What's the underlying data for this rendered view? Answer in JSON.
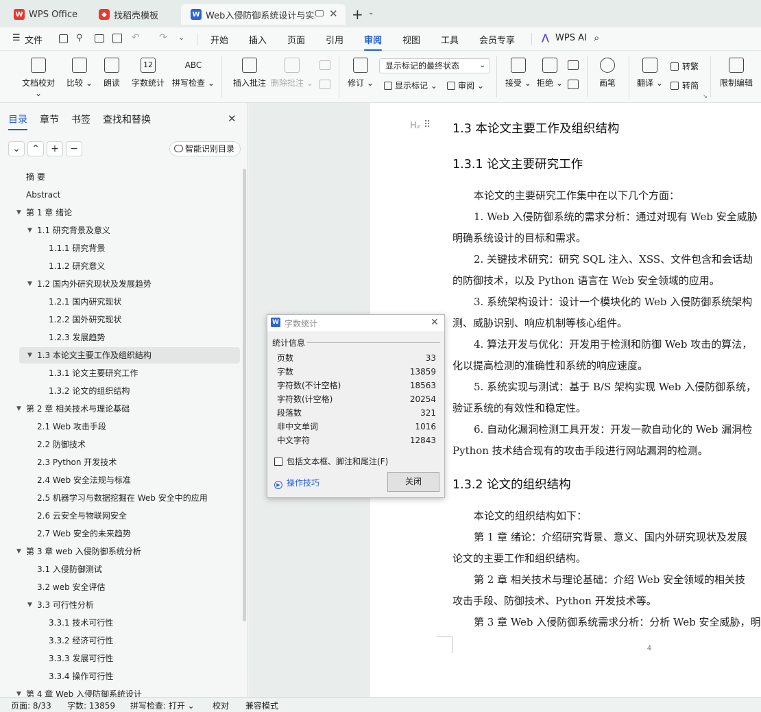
{
  "tabs": [
    {
      "label": "WPS Office",
      "icon": "wps-logo-icon"
    },
    {
      "label": "找稻壳模板",
      "icon": "docer-icon"
    },
    {
      "label": "Web入侵防御系统设计与实现",
      "icon": "word-doc-icon"
    }
  ],
  "menu": {
    "file": "文件",
    "items": [
      "开始",
      "插入",
      "页面",
      "引用",
      "审阅",
      "视图",
      "工具",
      "会员专享"
    ],
    "active": "审阅",
    "ai": "WPS AI"
  },
  "ribbon": {
    "doc_check": "文档校对",
    "compare": "比较",
    "read_aloud": "朗读",
    "word_count": "字数统计",
    "word_count_icon_text": "12",
    "spell_check": "拼写检查",
    "spell_icon_text": "ABC",
    "insert_comment": "插入批注",
    "delete_comment": "删除批注",
    "revise": "修订",
    "markup_select": "显示标记的最终状态",
    "show_markup": "显示标记",
    "review": "审阅",
    "accept": "接受",
    "reject": "拒绝",
    "pen": "画笔",
    "translate": "翻译",
    "to_traditional": "转繁",
    "to_simplified": "转简",
    "restrict_edit": "限制编辑"
  },
  "panel": {
    "tabs": [
      "目录",
      "章节",
      "书签",
      "查找和替换"
    ],
    "smart_toc": "智能识别目录",
    "toc": [
      {
        "text": "摘 要",
        "level": 0
      },
      {
        "text": "Abstract",
        "level": 0
      },
      {
        "text": "第 1 章 绪论",
        "level": 0,
        "toggle": true
      },
      {
        "text": "1.1 研究背景及意义",
        "level": 1,
        "toggle": true
      },
      {
        "text": "1.1.1 研究背景",
        "level": 2
      },
      {
        "text": "1.1.2 研究意义",
        "level": 2
      },
      {
        "text": "1.2 国内外研究现状及发展趋势",
        "level": 1,
        "toggle": true
      },
      {
        "text": "1.2.1 国内研究现状",
        "level": 2
      },
      {
        "text": "1.2.2 国外研究现状",
        "level": 2
      },
      {
        "text": "1.2.3 发展趋势",
        "level": 2
      },
      {
        "text": "1.3 本论文主要工作及组织结构",
        "level": 1,
        "toggle": true,
        "selected": true
      },
      {
        "text": "1.3.1 论文主要研究工作",
        "level": 2
      },
      {
        "text": "1.3.2 论文的组织结构",
        "level": 2
      },
      {
        "text": "第 2 章 相关技术与理论基础",
        "level": 0,
        "toggle": true
      },
      {
        "text": "2.1 Web 攻击手段",
        "level": 1
      },
      {
        "text": "2.2 防御技术",
        "level": 1
      },
      {
        "text": "2.3 Python 开发技术",
        "level": 1
      },
      {
        "text": "2.4 Web 安全法规与标准",
        "level": 1
      },
      {
        "text": "2.5 机器学习与数据挖掘在 Web 安全中的应用",
        "level": 1
      },
      {
        "text": "2.6 云安全与物联网安全",
        "level": 1
      },
      {
        "text": "2.7 Web 安全的未来趋势",
        "level": 1
      },
      {
        "text": "第 3 章 web 入侵防御系统分析",
        "level": 0,
        "toggle": true
      },
      {
        "text": "3.1 入侵防御测试",
        "level": 1
      },
      {
        "text": "3.2 web 安全评估",
        "level": 1
      },
      {
        "text": "3.3 可行性分析",
        "level": 1,
        "toggle": true
      },
      {
        "text": "3.3.1 技术可行性",
        "level": 2
      },
      {
        "text": "3.3.2 经济可行性",
        "level": 2
      },
      {
        "text": "3.3.3 发展可行性",
        "level": 2
      },
      {
        "text": "3.3.4 操作可行性",
        "level": 2
      },
      {
        "text": "第 4 章 Web 入侵防御系统设计",
        "level": 0,
        "toggle": true
      }
    ]
  },
  "document": {
    "h2_marker": "H₂",
    "page_number": "4",
    "lines": [
      {
        "t": "h",
        "text": "1.3  本论文主要工作及组织结构"
      },
      {
        "t": "h",
        "text": "1.3.1  论文主要研究工作"
      },
      {
        "t": "p",
        "text": "本论文的主要研究工作集中在以下几个方面："
      },
      {
        "t": "p",
        "text": "1. Web 入侵防御系统的需求分析：通过对现有 Web 安全威胁"
      },
      {
        "t": "c",
        "text": "明确系统设计的目标和需求。"
      },
      {
        "t": "p",
        "text": "2. 关键技术研究：研究 SQL 注入、XSS、文件包含和会话劫"
      },
      {
        "t": "c",
        "text": "的防御技术，以及 Python 语言在 Web 安全领域的应用。"
      },
      {
        "t": "p",
        "text": "3. 系统架构设计：设计一个模块化的 Web 入侵防御系统架构"
      },
      {
        "t": "c",
        "text": "测、威胁识别、响应机制等核心组件。"
      },
      {
        "t": "p",
        "text": "4. 算法开发与优化：开发用于检测和防御 Web 攻击的算法，"
      },
      {
        "t": "c",
        "text": "化以提高检测的准确性和系统的响应速度。"
      },
      {
        "t": "p",
        "text": "5. 系统实现与测试：基于 B/S 架构实现 Web 入侵防御系统，"
      },
      {
        "t": "c",
        "text": "验证系统的有效性和稳定性。"
      },
      {
        "t": "p",
        "text": "6. 自动化漏洞检测工具开发：开发一款自动化的 Web 漏洞检"
      },
      {
        "t": "c",
        "text": "Python 技术结合现有的攻击手段进行网站漏洞的检测。"
      },
      {
        "t": "h",
        "text": "1.3.2  论文的组织结构"
      },
      {
        "t": "p",
        "text": "本论文的组织结构如下："
      },
      {
        "t": "p",
        "text": "第 1 章  绪论：介绍研究背景、意义、国内外研究现状及发展"
      },
      {
        "t": "c",
        "text": "论文的主要工作和组织结构。"
      },
      {
        "t": "p",
        "text": "第 2 章  相关技术与理论基础：介绍 Web 安全领域的相关技"
      },
      {
        "t": "c",
        "text": "攻击手段、防御技术、Python 开发技术等。"
      },
      {
        "t": "p",
        "text": "第 3 章  Web 入侵防御系统需求分析：分析 Web 安全威胁，明"
      }
    ]
  },
  "dialog": {
    "title": "字数统计",
    "section": "统计信息",
    "rows": [
      {
        "label": "页数",
        "value": "33"
      },
      {
        "label": "字数",
        "value": "13859"
      },
      {
        "label": "字符数(不计空格)",
        "value": "18563"
      },
      {
        "label": "字符数(计空格)",
        "value": "20254"
      },
      {
        "label": "段落数",
        "value": "321"
      },
      {
        "label": "非中文单词",
        "value": "1016"
      },
      {
        "label": "中文字符",
        "value": "12843"
      }
    ],
    "checkbox_label": "包括文本框、脚注和尾注(F)",
    "checkbox_checked": false,
    "tips": "操作技巧",
    "close": "关闭"
  },
  "status": {
    "page": "页面: 8/33",
    "words": "字数: 13859",
    "spell": "拼写检查: 打开",
    "proof": "校对",
    "compat": "兼容模式"
  },
  "colors": {
    "accent": "#1f5fd0",
    "wps_red": "#e8392f",
    "word_blue": "#2b63d9"
  }
}
